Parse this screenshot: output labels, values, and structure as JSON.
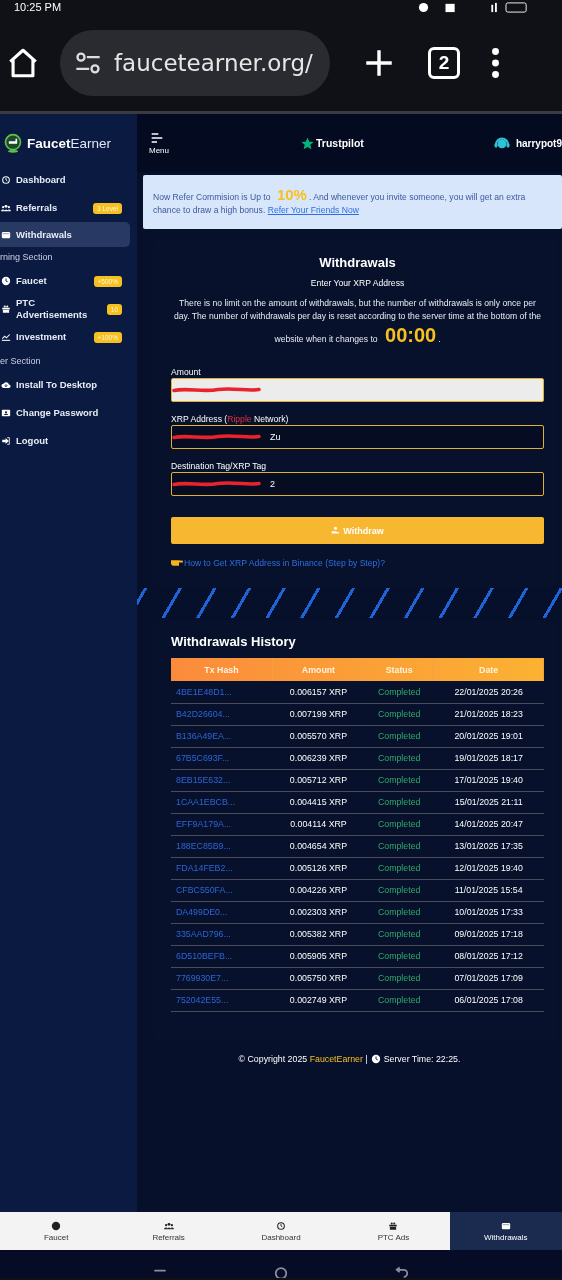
{
  "status_bar": {
    "time": "10:25 PM"
  },
  "browser": {
    "url": "faucetearner.org/",
    "tab_count": "2"
  },
  "sidebar": {
    "logo": {
      "bold": "Faucet",
      "light": "Earner"
    },
    "items": [
      {
        "kind": "item",
        "label": "Dashboard",
        "selected": false
      },
      {
        "kind": "item",
        "label": "Referrals",
        "badge": "3 Level",
        "selected": false
      },
      {
        "kind": "item",
        "label": "Withdrawals",
        "selected": true
      },
      {
        "kind": "section",
        "label": "rning Section"
      },
      {
        "kind": "item",
        "label": "Faucet",
        "badge": "+500%",
        "selected": false
      },
      {
        "kind": "item",
        "label": "PTC Advertisements",
        "badge": "10",
        "selected": false
      },
      {
        "kind": "item",
        "label": "Investment",
        "badge": "+100%",
        "selected": false
      },
      {
        "kind": "section",
        "label": "er Section"
      },
      {
        "kind": "item",
        "label": "Install To Desktop",
        "selected": false
      },
      {
        "kind": "item",
        "label": "Change Password",
        "selected": false
      },
      {
        "kind": "item",
        "label": "Logout",
        "selected": false
      }
    ]
  },
  "header": {
    "menu_label": "Menu",
    "trustpilot": "Trustpilot",
    "username": "harrypot9"
  },
  "notice": {
    "text": "Now Refer Commision is Up to **10%**. And whenever you invite someone, you will get an extra chance to draw a high bonus.",
    "link": "Refer Your Friends Now"
  },
  "withdraw_form": {
    "title": "Withdrawals",
    "subtitle": "Enter Your XRP Address",
    "description": "There is no limit on the amount of withdrawals, but the number of withdrawals is only once per day. The number of withdrawals per day is reset according to the server time at the bottom of the website when it changes to **00:00**.",
    "fields": [
      {
        "label": "Amount",
        "readonly": true,
        "redacted": true
      },
      {
        "label": "XRP Address (",
        "highlight": "Ripple",
        "label_end": " Network)",
        "readonly": false,
        "redacted": true,
        "value": "Zu"
      },
      {
        "label": "Destination Tag/XRP Tag",
        "readonly": false,
        "redacted": true,
        "value": "2"
      }
    ],
    "button": "Withdraw",
    "help_link": "How to Get XRP Address in Binance (Step by Step)?"
  },
  "history": {
    "title": "Withdrawals History",
    "columns": [
      "Tx Hash",
      "Amount",
      "Status",
      "Date"
    ],
    "rows": [
      {
        "tx_hash": "4BE1E48D1...",
        "amount": "0.006157 XRP",
        "status": "Completed",
        "date": "22/01/2025 20:26"
      },
      {
        "tx_hash": "B42D26604...",
        "amount": "0.007199 XRP",
        "status": "Completed",
        "date": "21/01/2025 18:23"
      },
      {
        "tx_hash": "B136A49EA...",
        "amount": "0.005570 XRP",
        "status": "Completed",
        "date": "20/01/2025 19:01"
      },
      {
        "tx_hash": "67B5C693F...",
        "amount": "0.006239 XRP",
        "status": "Completed",
        "date": "19/01/2025 18:17"
      },
      {
        "tx_hash": "8EB15E632...",
        "amount": "0.005712 XRP",
        "status": "Completed",
        "date": "17/01/2025 19:40"
      },
      {
        "tx_hash": "1CAA1EBCB...",
        "amount": "0.004415 XRP",
        "status": "Completed",
        "date": "15/01/2025 21:11"
      },
      {
        "tx_hash": "EFF9A179A...",
        "amount": "0.004114 XRP",
        "status": "Completed",
        "date": "14/01/2025 20:47"
      },
      {
        "tx_hash": "188EC85B9...",
        "amount": "0.004654 XRP",
        "status": "Completed",
        "date": "13/01/2025 17:35"
      },
      {
        "tx_hash": "FDA14FEB2...",
        "amount": "0.005126 XRP",
        "status": "Completed",
        "date": "12/01/2025 19:40"
      },
      {
        "tx_hash": "CFBC550FA...",
        "amount": "0.004226 XRP",
        "status": "Completed",
        "date": "11/01/2025 15:54"
      },
      {
        "tx_hash": "DA499DE0...",
        "amount": "0.002303 XRP",
        "status": "Completed",
        "date": "10/01/2025 17:33"
      },
      {
        "tx_hash": "335AAD796...",
        "amount": "0.005382 XRP",
        "status": "Completed",
        "date": "09/01/2025 17:18"
      },
      {
        "tx_hash": "6D510BEFB...",
        "amount": "0.005905 XRP",
        "status": "Completed",
        "date": "08/01/2025 17:12"
      },
      {
        "tx_hash": "7769930E7...",
        "amount": "0.005750 XRP",
        "status": "Completed",
        "date": "07/01/2025 17:09"
      },
      {
        "tx_hash": "752042E55...",
        "amount": "0.002749 XRP",
        "status": "Completed",
        "date": "06/01/2025 17:08"
      }
    ]
  },
  "footer": {
    "copyright": "© Copyright 2025",
    "brand": "FaucetEarner",
    "separator": "|",
    "server_time": "Server Time: 22:25."
  },
  "bottom_nav": [
    {
      "label": "Faucet",
      "selected": false
    },
    {
      "label": "Referrals",
      "selected": false
    },
    {
      "label": "Dashboard",
      "selected": false
    },
    {
      "label": "PTC Ads",
      "selected": false
    },
    {
      "label": "Withdrawals",
      "selected": true
    }
  ]
}
